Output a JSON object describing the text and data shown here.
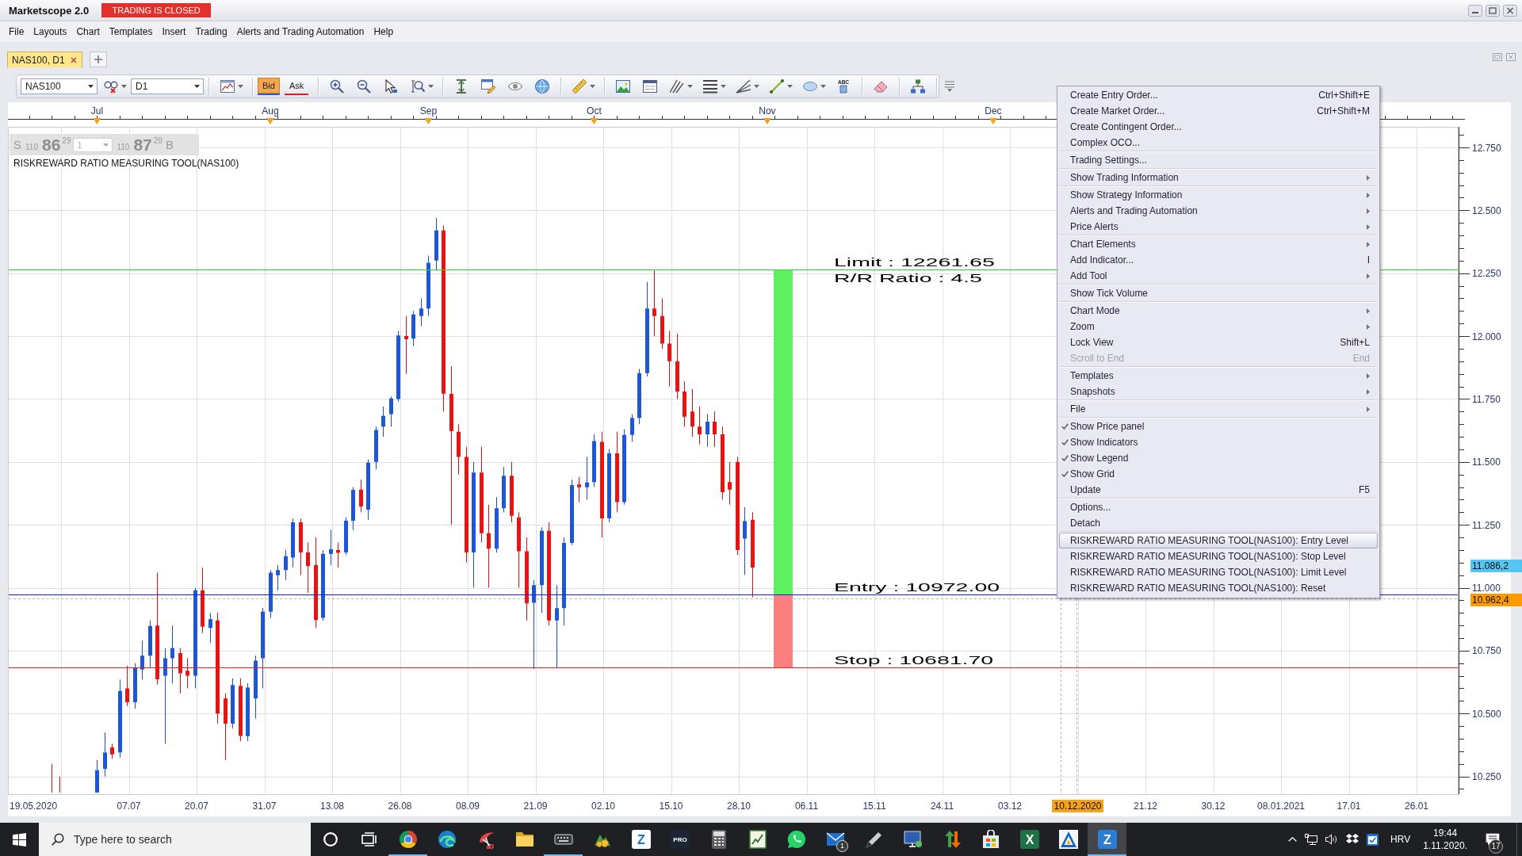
{
  "window": {
    "title": "Marketscope 2.0",
    "trading_status": "TRADING IS CLOSED"
  },
  "menu_bar": [
    "File",
    "Layouts",
    "Chart",
    "Templates",
    "Insert",
    "Trading",
    "Alerts and Trading Automation",
    "Help"
  ],
  "tabs": [
    {
      "label": "NAS100, D1",
      "selected": true
    }
  ],
  "toolbar": {
    "symbol": "NAS100",
    "timeframe": "D1",
    "price_buttons": [
      {
        "label": "Bid",
        "selected": true,
        "color": "#2a5bd7"
      },
      {
        "label": "Ask",
        "selected": false,
        "color": "#e02020"
      }
    ],
    "text_tool_glyph": "ABC"
  },
  "chart": {
    "month_labels": [
      "Jul",
      "Aug",
      "Sep",
      "Oct",
      "Nov",
      "Dec"
    ],
    "price_panel": {
      "sell": {
        "side": "S",
        "prefix": "110",
        "pips": "86",
        "fraction": "29"
      },
      "amount": "1",
      "buy": {
        "prefix": "110",
        "pips": "87",
        "fraction": "29",
        "side": "B"
      }
    },
    "legend": "RISKREWARD RATIO MEASURING TOOL(NAS100)",
    "tool_labels": [
      {
        "kind": "limit",
        "text": "Limit : 12261.65"
      },
      {
        "kind": "ratio",
        "text": "R/R Ratio : 4.5"
      },
      {
        "kind": "entry",
        "text": "Entry : 10972.00"
      },
      {
        "kind": "stop",
        "text": "Stop : 10681.70"
      }
    ],
    "price_axis_labels": [
      "12.750",
      "12.500",
      "12.250",
      "12.000",
      "11.750",
      "11.500",
      "11.250",
      "11.000",
      "10.750",
      "10.500",
      "10.250"
    ],
    "price_tags": [
      {
        "text": "11.086,2",
        "color": "#55c5f2"
      },
      {
        "text": "10.962,4",
        "color": "#ff9a00"
      }
    ],
    "date_axis_labels": [
      {
        "text": "19.05.2020",
        "highlighted": false
      },
      {
        "text": "07.07",
        "highlighted": false
      },
      {
        "text": "20.07",
        "highlighted": false
      },
      {
        "text": "31.07",
        "highlighted": false
      },
      {
        "text": "13.08",
        "highlighted": false
      },
      {
        "text": "26.08",
        "highlighted": false
      },
      {
        "text": "08.09",
        "highlighted": false
      },
      {
        "text": "21.09",
        "highlighted": false
      },
      {
        "text": "02.10",
        "highlighted": false
      },
      {
        "text": "15.10",
        "highlighted": false
      },
      {
        "text": "28.10",
        "highlighted": false
      },
      {
        "text": "06.11",
        "highlighted": false
      },
      {
        "text": "15.11",
        "highlighted": false
      },
      {
        "text": "24.11",
        "highlighted": false
      },
      {
        "text": "03.12",
        "highlighted": false
      },
      {
        "text": "10.12.2020",
        "highlighted": true
      },
      {
        "text": "21.12",
        "highlighted": false
      },
      {
        "text": "30.12",
        "highlighted": false
      },
      {
        "text": "08.01.2021",
        "highlighted": false
      },
      {
        "text": "17.01",
        "highlighted": false
      },
      {
        "text": "26.01",
        "highlighted": false
      }
    ]
  },
  "context_menu": {
    "groups": [
      [
        {
          "label": "Create Entry Order...",
          "shortcut": "Ctrl+Shift+E",
          "submenu": false,
          "checked": false,
          "disabled": false,
          "selected": false
        },
        {
          "label": "Create Market Order...",
          "shortcut": "Ctrl+Shift+M",
          "submenu": false,
          "checked": false,
          "disabled": false,
          "selected": false
        },
        {
          "label": "Create Contingent Order...",
          "submenu": false,
          "checked": false,
          "disabled": false,
          "selected": false
        },
        {
          "label": "Complex OCO...",
          "submenu": false,
          "checked": false,
          "disabled": false,
          "selected": false
        }
      ],
      [
        {
          "label": "Trading Settings...",
          "submenu": false,
          "checked": false,
          "disabled": false,
          "selected": false
        }
      ],
      [
        {
          "label": "Show Trading Information",
          "submenu": true,
          "checked": false,
          "disabled": false,
          "selected": false
        }
      ],
      [
        {
          "label": "Show Strategy Information",
          "submenu": true,
          "checked": false,
          "disabled": false,
          "selected": false
        },
        {
          "label": "Alerts and Trading Automation",
          "submenu": true,
          "checked": false,
          "disabled": false,
          "selected": false
        },
        {
          "label": "Price Alerts",
          "submenu": true,
          "checked": false,
          "disabled": false,
          "selected": false
        }
      ],
      [
        {
          "label": "Chart Elements",
          "submenu": true,
          "checked": false,
          "disabled": false,
          "selected": false
        },
        {
          "label": "Add Indicator...",
          "shortcut": "I",
          "submenu": false,
          "checked": false,
          "disabled": false,
          "selected": false
        },
        {
          "label": "Add Tool",
          "submenu": true,
          "checked": false,
          "disabled": false,
          "selected": false
        }
      ],
      [
        {
          "label": "Show Tick Volume",
          "submenu": false,
          "checked": false,
          "disabled": false,
          "selected": false
        }
      ],
      [
        {
          "label": "Chart Mode",
          "submenu": true,
          "checked": false,
          "disabled": false,
          "selected": false
        },
        {
          "label": "Zoom",
          "submenu": true,
          "checked": false,
          "disabled": false,
          "selected": false
        },
        {
          "label": "Lock View",
          "shortcut": "Shift+L",
          "submenu": false,
          "checked": false,
          "disabled": false,
          "selected": false
        },
        {
          "label": "Scroll to End",
          "shortcut": "End",
          "submenu": false,
          "checked": false,
          "disabled": true,
          "selected": false
        }
      ],
      [
        {
          "label": "Templates",
          "submenu": true,
          "checked": false,
          "disabled": false,
          "selected": false
        },
        {
          "label": "Snapshots",
          "submenu": true,
          "checked": false,
          "disabled": false,
          "selected": false
        }
      ],
      [
        {
          "label": "File",
          "submenu": true,
          "checked": false,
          "disabled": false,
          "selected": false
        }
      ],
      [
        {
          "label": "Show Price panel",
          "submenu": false,
          "checked": true,
          "disabled": false,
          "selected": false
        },
        {
          "label": "Show Indicators",
          "submenu": false,
          "checked": true,
          "disabled": false,
          "selected": false
        },
        {
          "label": "Show Legend",
          "submenu": false,
          "checked": true,
          "disabled": false,
          "selected": false
        },
        {
          "label": "Show Grid",
          "submenu": false,
          "checked": true,
          "disabled": false,
          "selected": false
        },
        {
          "label": "Update",
          "shortcut": "F5",
          "submenu": false,
          "checked": false,
          "disabled": false,
          "selected": false
        }
      ],
      [
        {
          "label": "Options...",
          "submenu": false,
          "checked": false,
          "disabled": false,
          "selected": false
        },
        {
          "label": "Detach",
          "submenu": false,
          "checked": false,
          "disabled": false,
          "selected": false
        }
      ],
      [
        {
          "label": "RISKREWARD RATIO MEASURING TOOL(NAS100): Entry Level",
          "submenu": false,
          "checked": false,
          "disabled": false,
          "selected": true
        },
        {
          "label": "RISKREWARD RATIO MEASURING TOOL(NAS100): Stop Level",
          "submenu": false,
          "checked": false,
          "disabled": false,
          "selected": false
        },
        {
          "label": "RISKREWARD RATIO MEASURING TOOL(NAS100): Limit Level",
          "submenu": false,
          "checked": false,
          "disabled": false,
          "selected": false
        },
        {
          "label": "RISKREWARD RATIO MEASURING TOOL(NAS100): Reset",
          "submenu": false,
          "checked": false,
          "disabled": false,
          "selected": false
        }
      ]
    ]
  },
  "taskbar": {
    "search": {
      "placeholder": "Type here to search"
    },
    "apps": [
      {
        "kind": "ring",
        "running": false,
        "selected": false
      },
      {
        "kind": "panes",
        "running": false,
        "selected": false
      },
      {
        "kind": "wheel",
        "running": true,
        "selected": false
      },
      {
        "kind": "swirl",
        "running": false,
        "selected": false
      },
      {
        "kind": "scissors",
        "running": false,
        "selected": false
      },
      {
        "kind": "folder",
        "running": false,
        "selected": false
      },
      {
        "kind": "keys",
        "running": true,
        "selected": false
      },
      {
        "kind": "coins",
        "running": false,
        "selected": false
      },
      {
        "kind": "tile",
        "glyph": "Z",
        "color": "#ffffff",
        "running": false,
        "selected": false
      },
      {
        "kind": "tile",
        "glyph": "PRO",
        "color": "#1c2533",
        "running": false,
        "selected": false
      },
      {
        "kind": "calculator",
        "running": false,
        "selected": false
      },
      {
        "kind": "notebook",
        "running": false,
        "selected": false
      },
      {
        "kind": "chat",
        "running": false,
        "selected": false
      },
      {
        "kind": "mail",
        "badge": "1",
        "running": false,
        "selected": false
      },
      {
        "kind": "pen",
        "running": false,
        "selected": false
      },
      {
        "kind": "monitor",
        "running": false,
        "selected": false
      },
      {
        "kind": "arrows",
        "running": false,
        "selected": false
      },
      {
        "kind": "bag",
        "running": false,
        "selected": false
      },
      {
        "kind": "tile",
        "glyph": "X",
        "color": "#1e7145",
        "running": false,
        "selected": false
      },
      {
        "kind": "triangle",
        "running": false,
        "selected": false
      },
      {
        "kind": "tile",
        "glyph": "Z",
        "color": "#2a7fd4",
        "running": true,
        "selected": true
      }
    ],
    "tray": {
      "language": "HRV",
      "time": "19:44",
      "date": "1.11.2020.",
      "notification_count": "17"
    }
  }
}
